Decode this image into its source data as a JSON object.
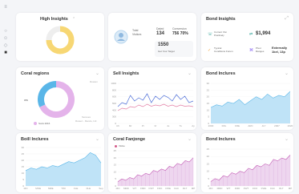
{
  "cards": {
    "high_insights": {
      "title": "High Insights"
    },
    "kpi": {
      "user_label": "Total",
      "user_value": "Visitors",
      "delta_label": "Dated",
      "delta_value": "134",
      "conv_label": "Conversion",
      "conv_value": "756 70%",
      "target_value": "1550",
      "target_label": "Get Your Target"
    },
    "bond_insights": {
      "title": "Bond Insights",
      "item1_label": "Current Visi",
      "item1_sub": "Positively",
      "item2_value": "$1,994",
      "item3_label": "Typical",
      "item3_sub": "Conditions Forum",
      "item4_label": "Pivot",
      "item4_sub": "Ranges",
      "item5_label": "Externally",
      "item5_value": "1kel, 13p"
    },
    "coral_regions": {
      "title": "Coral regions",
      "legend": "Sonk 2016",
      "label_left": "ws",
      "label_right_top": "Rowsm",
      "label_bottom1": "Sereses",
      "label_bottom2": "Rowez - Rendo, Intl"
    },
    "sell_insights": {
      "title": "Sell Insights"
    },
    "bond_inclures": {
      "title": "Bond Inclures"
    },
    "boill_inclures": {
      "title": "Boill Inclures"
    },
    "coral_fanjonge": {
      "title": "Coral Fanjonge",
      "legend": "Vlobe"
    },
    "bond_inclures2": {
      "title": "Bond Inclures"
    }
  },
  "chart_data": [
    {
      "type": "pie",
      "title": "High Insights",
      "values": [
        75,
        25
      ],
      "colors": [
        "#f7d774",
        "#eeeeee"
      ]
    },
    {
      "type": "pie",
      "title": "Coral regions",
      "values": [
        68,
        32
      ],
      "colors": [
        "#e4b3ea",
        "#5ab6e8"
      ]
    },
    {
      "type": "line",
      "title": "Sell Insights",
      "categories": [
        "Ch",
        "Mr",
        "Pr",
        "Fr",
        "Ju",
        "Tu",
        "Ay"
      ],
      "y_ticks": [
        "0",
        "300",
        "400",
        "500",
        "600",
        "800",
        "1000"
      ],
      "series": [
        {
          "color": "#4e6fd8",
          "values": [
            420,
            520,
            480,
            700,
            560,
            640,
            580,
            740,
            520,
            680,
            600,
            700,
            650,
            560,
            720,
            600,
            680,
            520,
            560
          ]
        },
        {
          "color": "#e27ca3",
          "values": [
            320,
            380,
            360,
            420,
            400,
            460,
            420,
            480,
            430,
            460,
            440,
            480,
            430,
            460,
            420,
            460,
            430,
            440,
            420
          ]
        }
      ]
    },
    {
      "type": "area",
      "title": "Bond Inclures",
      "categories": [
        "2000",
        "FRL",
        "FRE",
        "ARC",
        "JLY",
        "2007",
        "2020"
      ],
      "y_ticks": [
        "0",
        "5",
        "10",
        "15",
        "20",
        "25",
        "30"
      ],
      "values": [
        12,
        14,
        13,
        16,
        15,
        18,
        14,
        17,
        20,
        18,
        22,
        19,
        21,
        20,
        24
      ]
    },
    {
      "type": "area",
      "title": "Boill Inclures",
      "categories": [
        "MO",
        "MOE",
        "MRE",
        "TWI",
        "FLE",
        "FLE",
        "Sep"
      ],
      "y_ticks": [
        "0",
        "5",
        "10",
        "15",
        "20",
        "25",
        "30"
      ],
      "values": [
        12,
        14,
        13,
        15,
        14,
        16,
        15,
        17,
        19,
        18,
        20,
        22,
        26,
        24,
        18
      ]
    },
    {
      "type": "area",
      "title": "Coral Fanjonge",
      "categories": [
        "MO",
        "MRD",
        "WT",
        "FMD",
        "FWT",
        "FDO",
        "FWE",
        "FAC",
        "RLT",
        "MP"
      ],
      "y_ticks": [
        "0",
        "5",
        "10",
        "15",
        "20",
        "25"
      ],
      "values": [
        3,
        5,
        4,
        6,
        5,
        8,
        7,
        9,
        8,
        11,
        10,
        12,
        11,
        14,
        13,
        16,
        15,
        18,
        17,
        20
      ]
    },
    {
      "type": "area",
      "title": "Bond Inclures",
      "categories": [
        "MO",
        "MRD",
        "WT",
        "FMD",
        "FWT",
        "FDO",
        "FWE",
        "FAC",
        "RLT",
        "MP"
      ],
      "y_ticks": [
        "0",
        "5",
        "10",
        "15",
        "20",
        "25"
      ],
      "values": [
        3,
        5,
        4,
        7,
        6,
        9,
        8,
        10,
        9,
        12,
        11,
        14,
        13,
        15,
        14,
        18,
        17,
        19,
        18,
        21
      ]
    }
  ]
}
